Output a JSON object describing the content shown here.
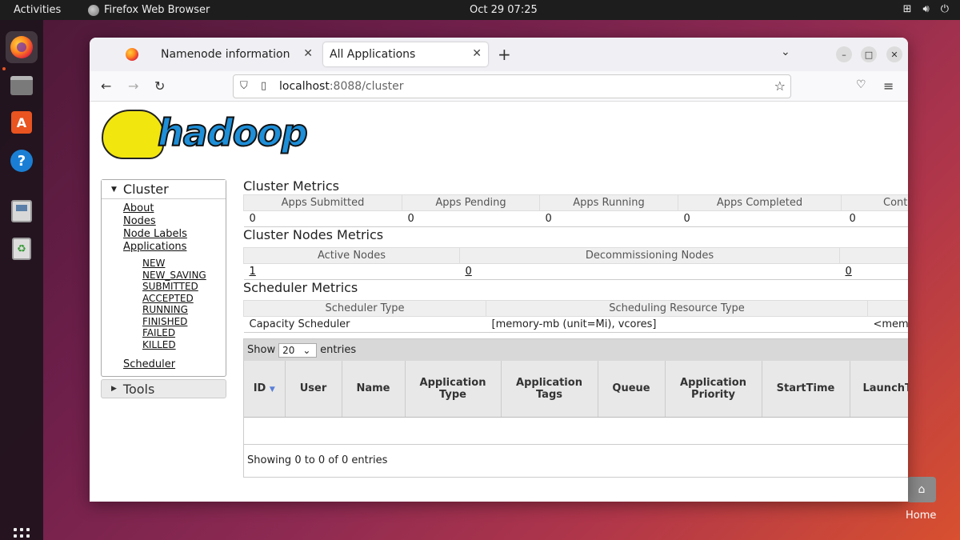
{
  "topbar": {
    "activities": "Activities",
    "app_name": "Firefox Web Browser",
    "clock": "Oct 29  07:25"
  },
  "dock": {
    "items": [
      "firefox-icon",
      "files-icon",
      "app-store-icon",
      "help-icon",
      "disk-icon",
      "trash-icon"
    ],
    "apps_grid": "show-apps-icon"
  },
  "desktop": {
    "home_label": "Home"
  },
  "browser": {
    "tabs": [
      {
        "label": "Namenode information"
      },
      {
        "label": "All Applications"
      }
    ],
    "url_host": "localhost",
    "url_path": ":8088/cluster"
  },
  "page": {
    "logo_text": "hadoop",
    "sidebar": {
      "cluster_label": "Cluster",
      "links": [
        "About",
        "Nodes",
        "Node Labels",
        "Applications"
      ],
      "app_states": [
        "NEW",
        "NEW_SAVING",
        "SUBMITTED",
        "ACCEPTED",
        "RUNNING",
        "FINISHED",
        "FAILED",
        "KILLED"
      ],
      "scheduler_link": "Scheduler",
      "tools_label": "Tools"
    },
    "cluster_metrics": {
      "title": "Cluster Metrics",
      "headers": [
        "Apps Submitted",
        "Apps Pending",
        "Apps Running",
        "Apps Completed",
        "Cont"
      ],
      "values": [
        "0",
        "0",
        "0",
        "0",
        "0"
      ]
    },
    "nodes_metrics": {
      "title": "Cluster Nodes Metrics",
      "headers": [
        "Active Nodes",
        "Decommissioning Nodes",
        ""
      ],
      "values": [
        "1",
        "0",
        "0"
      ]
    },
    "scheduler_metrics": {
      "title": "Scheduler Metrics",
      "headers": [
        "Scheduler Type",
        "Scheduling Resource Type",
        ""
      ],
      "values": [
        "Capacity Scheduler",
        "[memory-mb (unit=Mi), vcores]",
        "<mem"
      ]
    },
    "apps_table": {
      "show_label": "Show",
      "page_size": "20",
      "entries_label": "entries",
      "columns": [
        "ID",
        "User",
        "Name",
        "Application Type",
        "Application Tags",
        "Queue",
        "Application Priority",
        "StartTime",
        "LaunchT"
      ],
      "footer": "Showing 0 to 0 of 0 entries"
    }
  },
  "colors": {
    "hadoop_blue": "#1e8fd8",
    "elephant_yellow": "#f2e60f",
    "ubuntu_orange": "#e95420"
  }
}
